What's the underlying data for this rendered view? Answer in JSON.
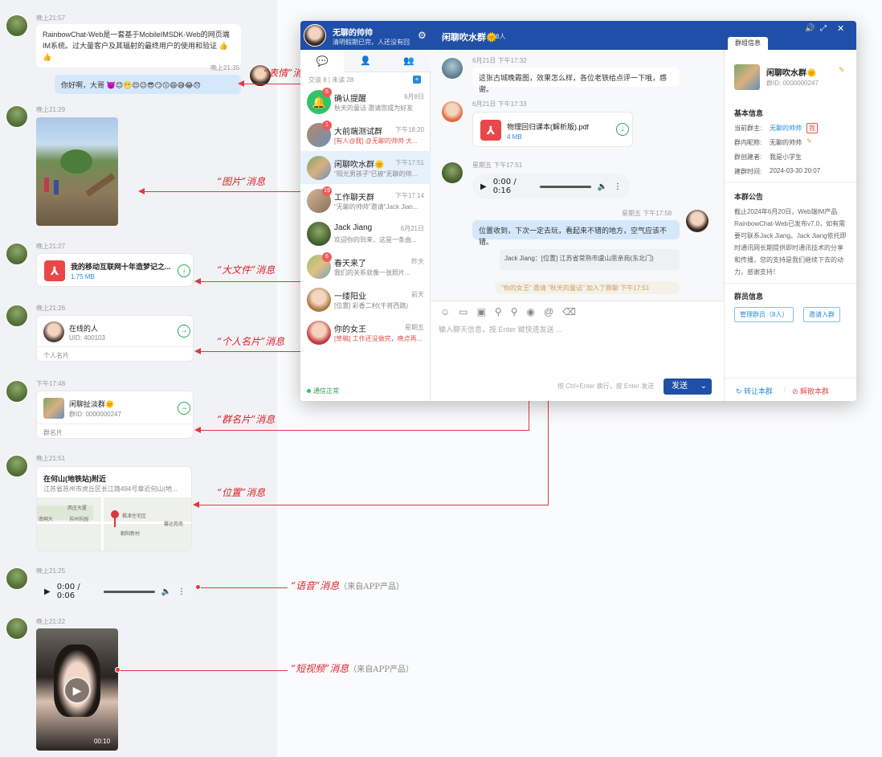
{
  "left": {
    "msg1": {
      "time": "晚上21:57",
      "text": "RainbowChat-Web是一套基于MobileIMSDK-Web的网页端IM系统。过大量客户及其辐射的最终用户的使用和验证 👍👍"
    },
    "msg2": {
      "time": "晚上21:35",
      "text": "你好啊，大哥 👿😊😬😌😉😎😏😗😄😅😂😞"
    },
    "msg3": {
      "time": "晚上21:29"
    },
    "msg4": {
      "time": "晚上21:27",
      "file": "我的移动互联网十年造梦记之...",
      "size": "1.75 MB"
    },
    "msg5": {
      "time": "晚上21:26",
      "name": "在线的人",
      "uid": "UID: 400103",
      "footer": "个人名片"
    },
    "msg6": {
      "time": "下午17:48",
      "name": "闲聊扯淡群🌞",
      "gid": "群ID: 0000000247",
      "footer": "群名片"
    },
    "msg7": {
      "time": "晚上21:51",
      "title": "在何山(地铁站)附近",
      "addr": "江苏省苏州市虎丘区长江路494号章近何山(地...",
      "maplabels": [
        "南翔大",
        "苏州乐园",
        "西庄大厦",
        "枫津住宅区",
        "朝阳新村",
        "馨达苑南"
      ]
    },
    "msg8": {
      "time": "晚上21:25",
      "audio": "0:00 / 0:06"
    },
    "msg9": {
      "time": "晚上21:22",
      "dur": "00:10"
    }
  },
  "annotations": {
    "emoji": "“表情”消息",
    "image": "“图片”消息",
    "bigfile": "“大文件”消息",
    "card": "“个人名片”消息",
    "groupcard": "“群名片”消息",
    "location": "“位置”消息",
    "voice": "“语音”消息",
    "voice_note": "（来自APP产品）",
    "video": "“短视频”消息",
    "video_note": "（来自APP产品）"
  },
  "win": {
    "user": "无聊的帅帅",
    "status": "清明假期已完，人还没有回",
    "tabs_count": "交谈 8 | 未读 28",
    "sessions": [
      {
        "name": "确认提醒",
        "time": "6月8日",
        "preview": "秋天的童话 邀请您成为好友",
        "badge": "5"
      },
      {
        "name": "大前端测试群",
        "time": "下午18:20",
        "preview": "[有人@我] @无聊的帅帅 大...",
        "badge": "1"
      },
      {
        "name": "闲聊吹水群🌞",
        "time": "下午17:51",
        "preview": "\"阳光男孩子\"已被\"无聊的帅...",
        "badge": ""
      },
      {
        "name": "工作聊天群",
        "time": "下午17:14",
        "preview": "\"无聊的帅帅\"邀请\"Jack Jian...",
        "badge": "19"
      },
      {
        "name": "Jack Jiang",
        "time": "6月21日",
        "preview": "欢迎你的到来，这是一条由...",
        "badge": ""
      },
      {
        "name": "春天来了",
        "time": "昨天",
        "preview": "我们的关系就像一张照片...",
        "badge": "6"
      },
      {
        "name": "一缕阳业",
        "time": "前天",
        "preview": "[位置] 彩香二村(干将西路)",
        "badge": ""
      },
      {
        "name": "你的女王",
        "time": "星期五",
        "preview": "[草稿] 工作还没做完，晚点再...",
        "badge": ""
      }
    ],
    "net": "通信正常",
    "chat_title": "闲聊吹水群🌞",
    "chat_count": "8人",
    "c1_time": "6月21日 下午17:32",
    "c1_text": "这张古城晚霞图，效果怎么样，各位老铁给点评一下哦，感谢。",
    "c2_time": "6月21日 下午17:33",
    "c2_file": "物理回归课本(解析版).pdf",
    "c2_size": "4 MB",
    "c3_time": "星期五 下午17:51",
    "c3_audio": "0:00 / 0:16",
    "c4_time": "星期五 下午17:58",
    "c4_text": "位置收到，下次一定去玩，看起来不错的地方，空气应该不错。",
    "c4_loc": "Jack Jiang：[位置] 江苏省常熟市虞山思亲苑(东北门)",
    "sys": "\"你的女王\" 邀请 \"秋天的童话\" 加入了群聊  下午17:51",
    "placeholder": "输入聊天信息，按 Enter 键快速发送 ...",
    "hint": "按 Ctrl+Enter 换行，按 Enter 发送",
    "send": "发送",
    "rp_tab": "群组信息",
    "rp_name": "闲聊吹水群🌞",
    "rp_gid": "群ID: 0000000247",
    "basic": "基本信息",
    "owner_k": "当前群主:",
    "owner_v": "无聊的帅帅",
    "owner_tag": "我",
    "nick_k": "群内昵称:",
    "nick_v": "无聊的帅帅",
    "creator_k": "群创建者:",
    "creator_v": "我是小学生",
    "ctime_k": "建群时间:",
    "ctime_v": "2024-03-30 20:07",
    "notice": "本群公告",
    "notice_text": "截止2024年6月20日，Web端IM产品RainbowChat-Web已发布v7.0，如有需要可联系Jack Jiang。Jack Jiang依托即时通讯网长期提供即时通讯技术的分享和传播，您的支持是我们继续下去的动力，感谢支持！",
    "members": "群员信息",
    "manage": "管理群员（8人）",
    "invite": "邀请入群",
    "transfer": "转让本群",
    "dissolve": "解散本群"
  }
}
